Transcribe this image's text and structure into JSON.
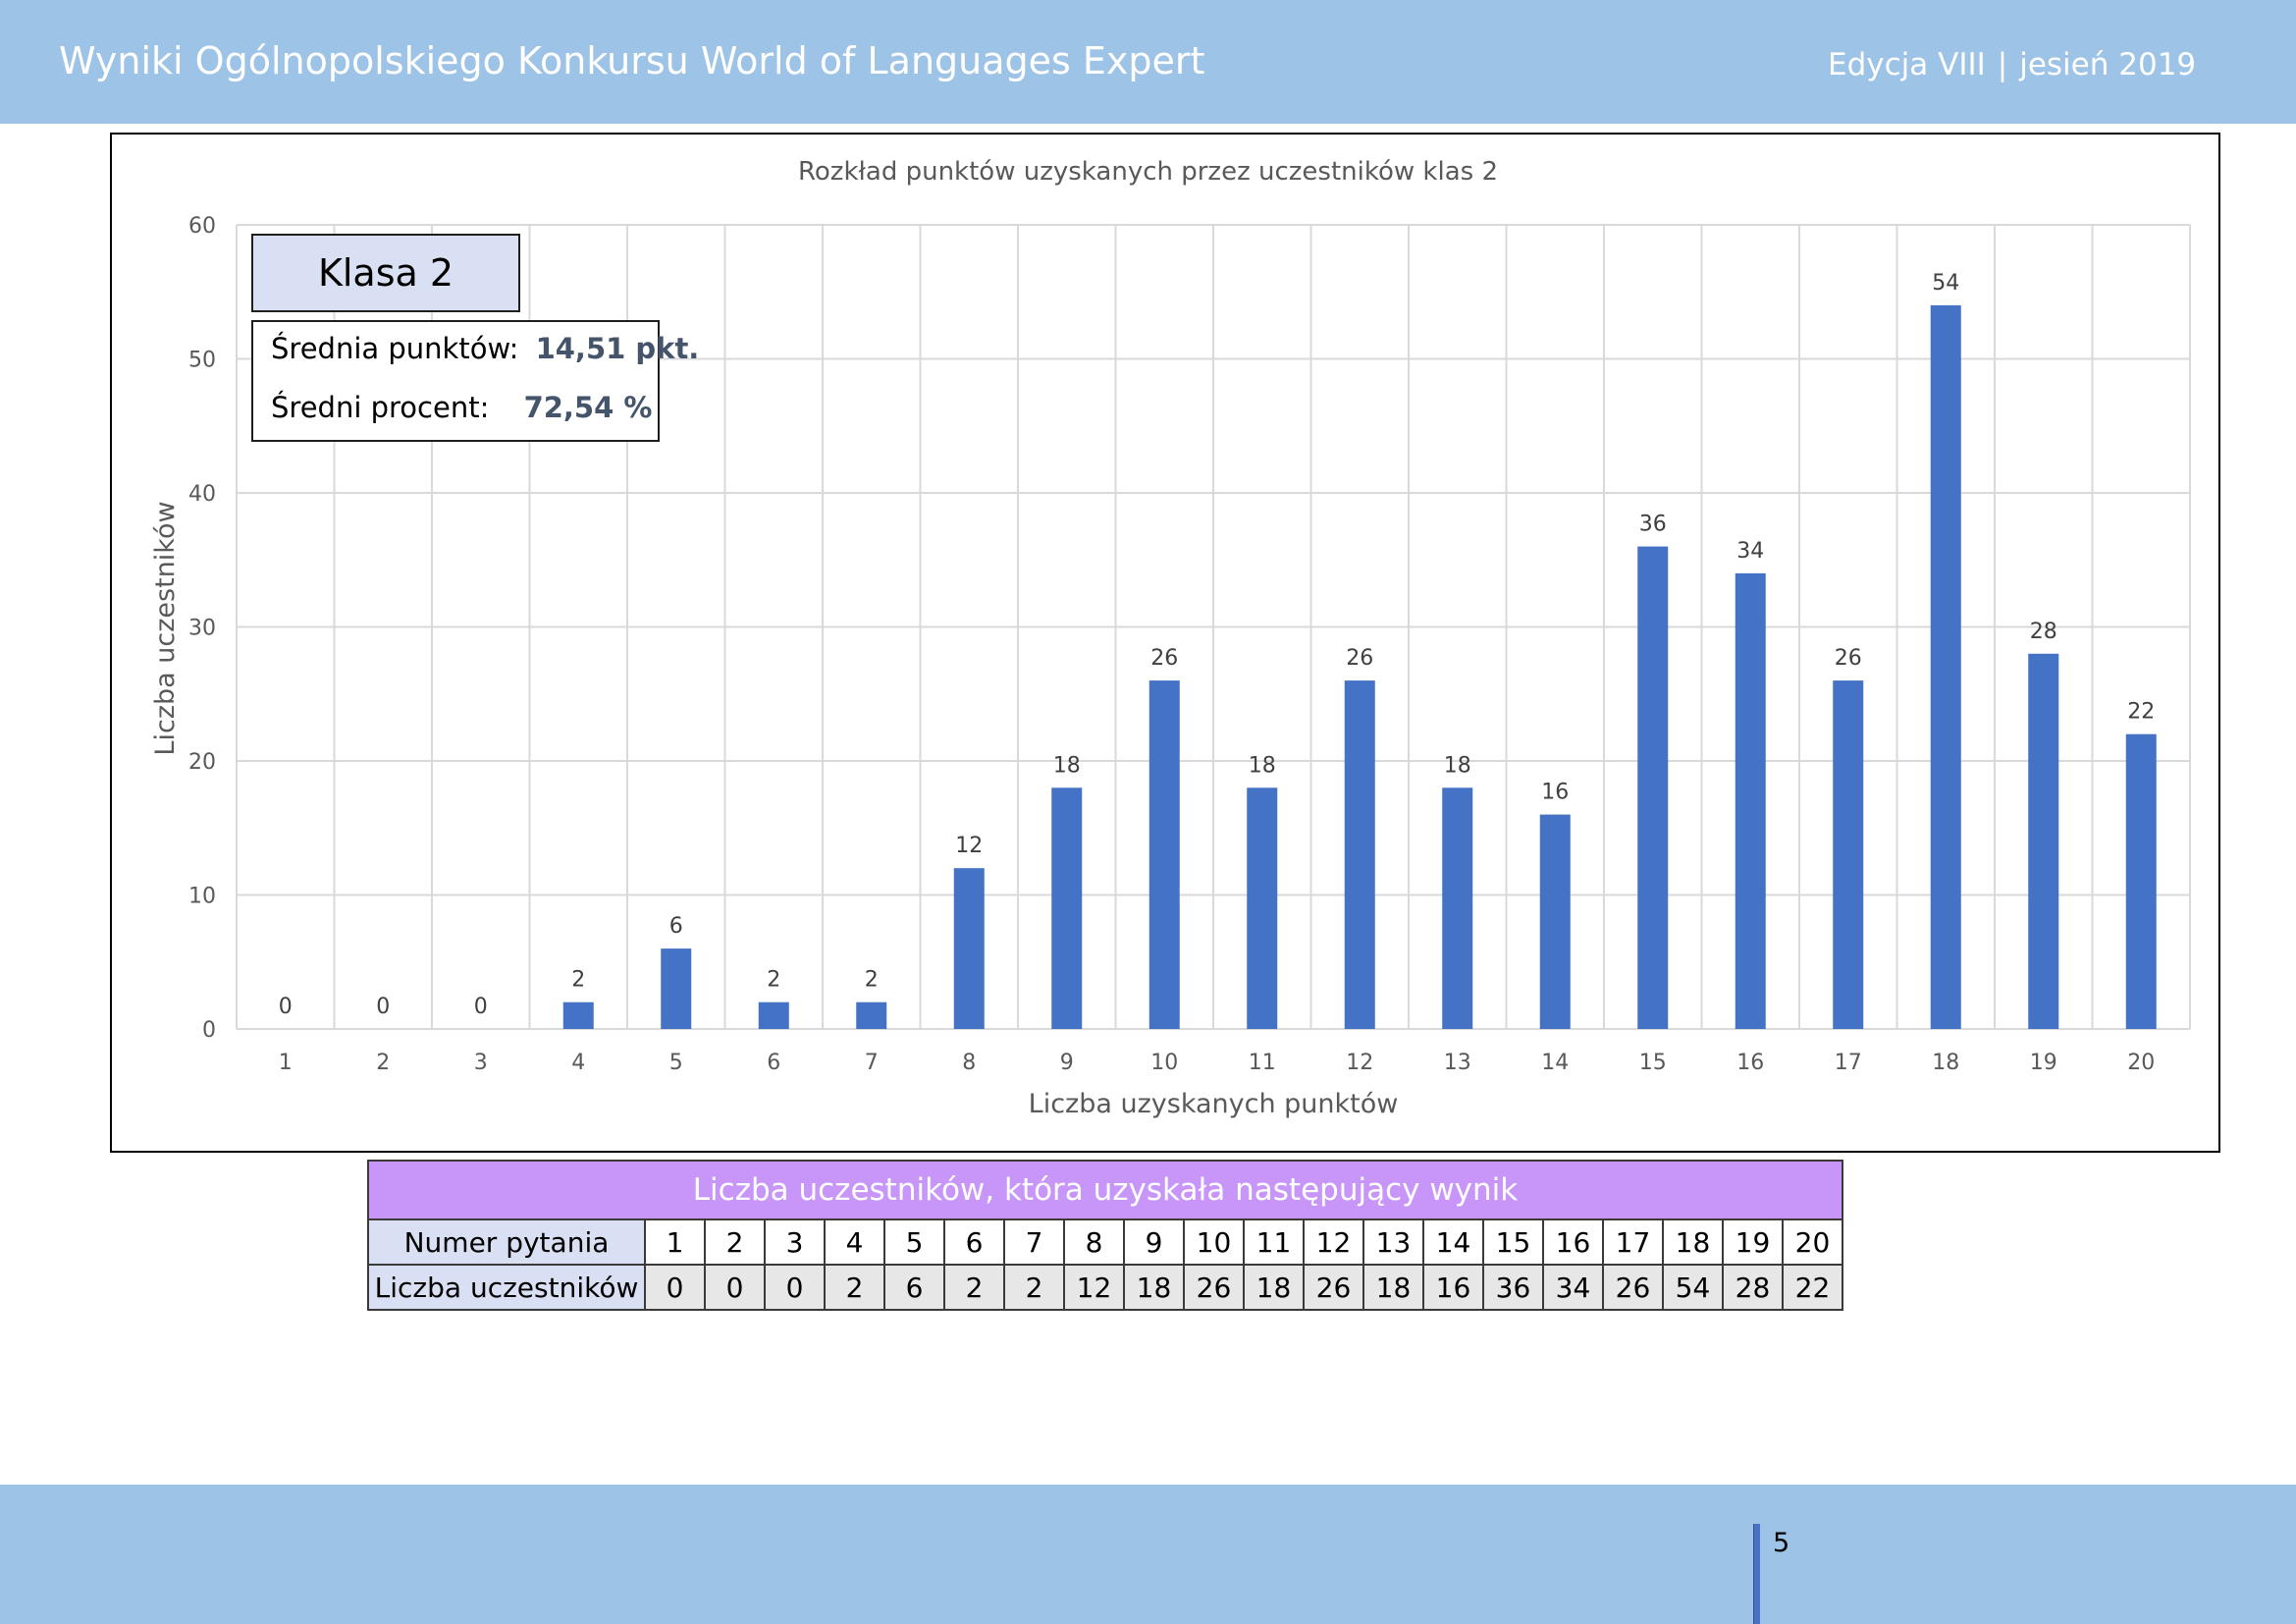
{
  "header": {
    "title": "Wyniki Ogólnopolskiego Konkursu World of Languages Expert",
    "edition": "Edycja VIII",
    "separator": "|",
    "season": "jesień 2019"
  },
  "class_box": {
    "label": "Klasa 2",
    "avg_points_label": "Średnia punktów:",
    "avg_points_value": "14,51 pkt.",
    "avg_percent_label": "Średni procent:",
    "avg_percent_value": "72,54 %"
  },
  "chart_data": {
    "type": "bar",
    "title": "Rozkład punktów uzyskanych przez uczestników klas 2",
    "xlabel": "Liczba uzyskanych punktów",
    "ylabel": "Liczba uczestników",
    "categories": [
      "1",
      "2",
      "3",
      "4",
      "5",
      "6",
      "7",
      "8",
      "9",
      "10",
      "11",
      "12",
      "13",
      "14",
      "15",
      "16",
      "17",
      "18",
      "19",
      "20"
    ],
    "values": [
      0,
      0,
      0,
      2,
      6,
      2,
      2,
      12,
      18,
      26,
      18,
      26,
      18,
      16,
      36,
      34,
      26,
      54,
      28,
      22
    ],
    "ylim": [
      0,
      60
    ],
    "yticks": [
      0,
      10,
      20,
      30,
      40,
      50,
      60
    ],
    "grid": true,
    "data_labels": true,
    "bar_color": "#4472c4"
  },
  "table": {
    "title": "Liczba uczestników, która uzyskała następujący wynik",
    "row1_label": "Numer pytania",
    "row2_label": "Liczba uczestników",
    "numbers": [
      "1",
      "2",
      "3",
      "4",
      "5",
      "6",
      "7",
      "8",
      "9",
      "10",
      "11",
      "12",
      "13",
      "14",
      "15",
      "16",
      "17",
      "18",
      "19",
      "20"
    ],
    "counts": [
      "0",
      "0",
      "0",
      "2",
      "6",
      "2",
      "2",
      "12",
      "18",
      "26",
      "18",
      "26",
      "18",
      "16",
      "36",
      "34",
      "26",
      "54",
      "28",
      "22"
    ]
  },
  "footer": {
    "page_number": "5"
  }
}
